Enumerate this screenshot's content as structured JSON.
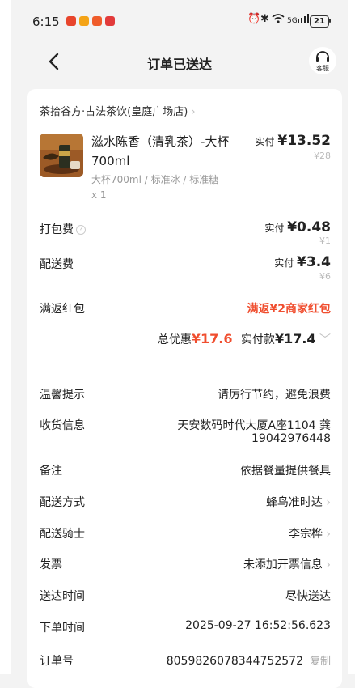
{
  "status": {
    "time": "6:15",
    "battery": "21",
    "signal": "5G"
  },
  "header": {
    "title": "订单已送达",
    "service_label": "客服"
  },
  "store": {
    "name": "茶拾谷方·古法茶饮(皇庭广场店)"
  },
  "product": {
    "name": "滋水陈香（清乳茶）-大杯700ml",
    "spec": "大杯700ml / 标准冰 / 标准糖",
    "qty": "x 1",
    "pay_prefix": "实付",
    "pay_price": "¥13.52",
    "orig_price": "¥28"
  },
  "fees": {
    "packing_label": "打包费",
    "packing_pay_prefix": "实付",
    "packing_pay": "¥0.48",
    "packing_orig": "¥1",
    "delivery_label": "配送费",
    "delivery_pay_prefix": "实付",
    "delivery_pay": "¥3.4",
    "delivery_orig": "¥6",
    "redpack_label": "满返红包",
    "redpack_value": "满返¥2商家红包"
  },
  "summary": {
    "discount_label": "总优惠",
    "discount_value": "¥17.6",
    "paid_label": "实付款",
    "paid_value": "¥17.4"
  },
  "info": {
    "tip_label": "温馨提示",
    "tip_value": "请厉行节约，避免浪费",
    "address_label": "收货信息",
    "address_value": "天安数码时代大厦A座1104 龚",
    "phone_value": "19042976448",
    "note_label": "备注",
    "note_value": "依据餐量提供餐具",
    "method_label": "配送方式",
    "method_value": "蜂鸟准时达",
    "rider_label": "配送骑士",
    "rider_value": "李宗桦",
    "invoice_label": "发票",
    "invoice_value": "未添加开票信息",
    "arrive_label": "送达时间",
    "arrive_value": "尽快送达",
    "order_time_label": "下单时间",
    "order_time_value": "2025-09-27 16:52:56.623",
    "order_no_label": "订单号",
    "order_no_value": "8059826078344752572",
    "copy_label": "复制"
  },
  "colors": {
    "accent_red": "#f04e2f",
    "background": "#f3f3f3"
  }
}
